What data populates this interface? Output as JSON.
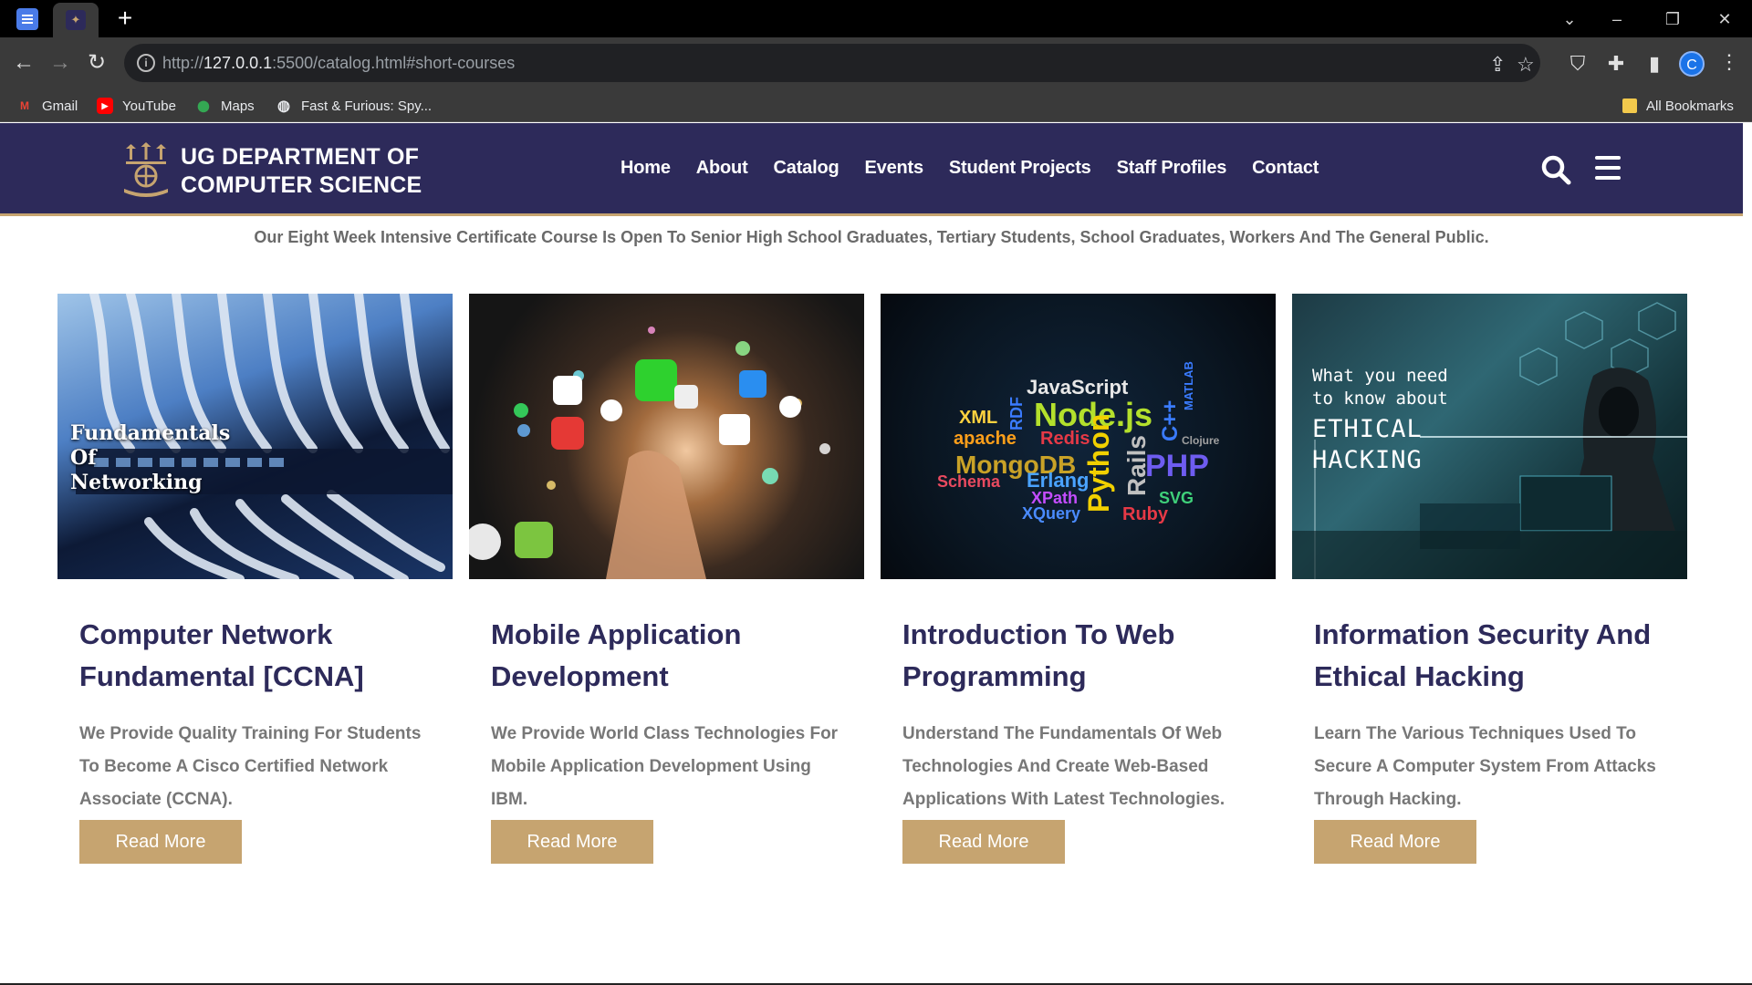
{
  "browser": {
    "url_prefix": "http://",
    "url_host": "127.0.0.1",
    "url_rest": ":5500/catalog.html#short-courses",
    "profile_initial": "C",
    "bookmarks": [
      {
        "label": "Gmail",
        "icon": "gmail-icon"
      },
      {
        "label": "YouTube",
        "icon": "youtube-icon"
      },
      {
        "label": "Maps",
        "icon": "maps-icon"
      },
      {
        "label": "Fast & Furious: Spy...",
        "icon": "globe-icon"
      }
    ],
    "all_bookmarks": "All Bookmarks"
  },
  "site": {
    "brand_line1": "UG DEPARTMENT OF",
    "brand_line2": "COMPUTER SCIENCE",
    "nav": [
      "Home",
      "About",
      "Catalog",
      "Events",
      "Student Projects",
      "Staff Profiles",
      "Contact"
    ],
    "intro": "Our Eight Week Intensive Certificate Course Is Open To Senior High School Graduates, Tertiary Students, School Graduates, Workers And The General Public.",
    "colors": {
      "primary": "#2d2a5a",
      "accent": "#c6a470"
    }
  },
  "courses": [
    {
      "title": "Computer Network Fundamental [CCNA]",
      "description": "We Provide Quality Training For Students To Become A Cisco Certified Network Associate (CCNA).",
      "button": "Read More",
      "image_text": [
        "Fundamentals",
        "Of",
        "Networking"
      ]
    },
    {
      "title": "Mobile Application Development",
      "description": "We Provide World Class Technologies For Mobile Application Development Using IBM.",
      "button": "Read More"
    },
    {
      "title": "Introduction To Web Programming",
      "description": "Understand The Fundamentals Of Web Technologies And Create Web-Based Applications With Latest Technologies.",
      "button": "Read More",
      "image_words": [
        "JavaScript",
        "Node.js",
        "XML",
        "apache",
        "Redis",
        "MongoDB",
        "Python",
        "Rails",
        "PHP",
        "Schema",
        "Erlang",
        "XPath",
        "XQuery",
        "SVG",
        "Ruby",
        "C++",
        "RDF",
        "MATLAB",
        "Clojure"
      ]
    },
    {
      "title": "Information Security And Ethical Hacking",
      "description": "Learn The Various Techniques Used To Secure A Computer System From Attacks Through Hacking.",
      "button": "Read More",
      "image_text": [
        "What you need",
        "to know about",
        "ETHICAL",
        "HACKING"
      ]
    }
  ]
}
